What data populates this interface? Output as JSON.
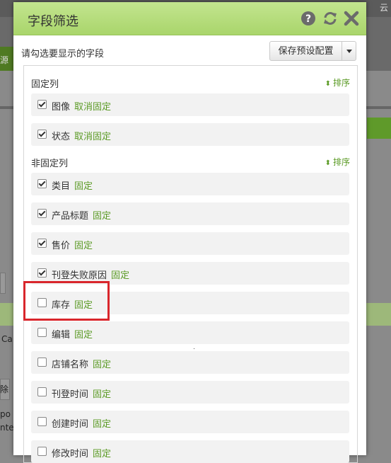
{
  "dialog": {
    "title": "字段筛选",
    "subtitle": "请勾选要显示的字段",
    "save_preset_label": "保存预设配置",
    "header_icons": [
      "help-icon",
      "refresh-icon",
      "close-icon"
    ]
  },
  "fixed_section": {
    "label": "固定列",
    "sort_label": "排序",
    "items": [
      {
        "label": "图像",
        "action": "取消固定",
        "checked": true
      },
      {
        "label": "状态",
        "action": "取消固定",
        "checked": true
      }
    ]
  },
  "unfixed_section": {
    "label": "非固定列",
    "sort_label": "排序",
    "items": [
      {
        "label": "类目",
        "action": "固定",
        "checked": true
      },
      {
        "label": "产品标题",
        "action": "固定",
        "checked": true
      },
      {
        "label": "售价",
        "action": "固定",
        "checked": true
      },
      {
        "label": "刊登失败原因",
        "action": "固定",
        "checked": true
      },
      {
        "label": "库存",
        "action": "固定",
        "checked": false
      },
      {
        "label": "编辑",
        "action": "固定",
        "checked": false
      },
      {
        "label": "店铺名称",
        "action": "固定",
        "checked": false
      },
      {
        "label": "刊登时间",
        "action": "固定",
        "checked": false
      },
      {
        "label": "创建时间",
        "action": "固定",
        "checked": false
      },
      {
        "label": "修改时间",
        "action": "固定",
        "checked": false
      }
    ]
  },
  "background": {
    "left_tab_fragment": "源",
    "left_text_1": "Ca",
    "left_text_2": "除",
    "left_text_3": "po",
    "left_text_4": "nte",
    "top_right_fragment": "云"
  },
  "colors": {
    "header_green": "#b4dc7a",
    "link_green": "#5a9a24",
    "highlight_red": "#d9262c"
  }
}
